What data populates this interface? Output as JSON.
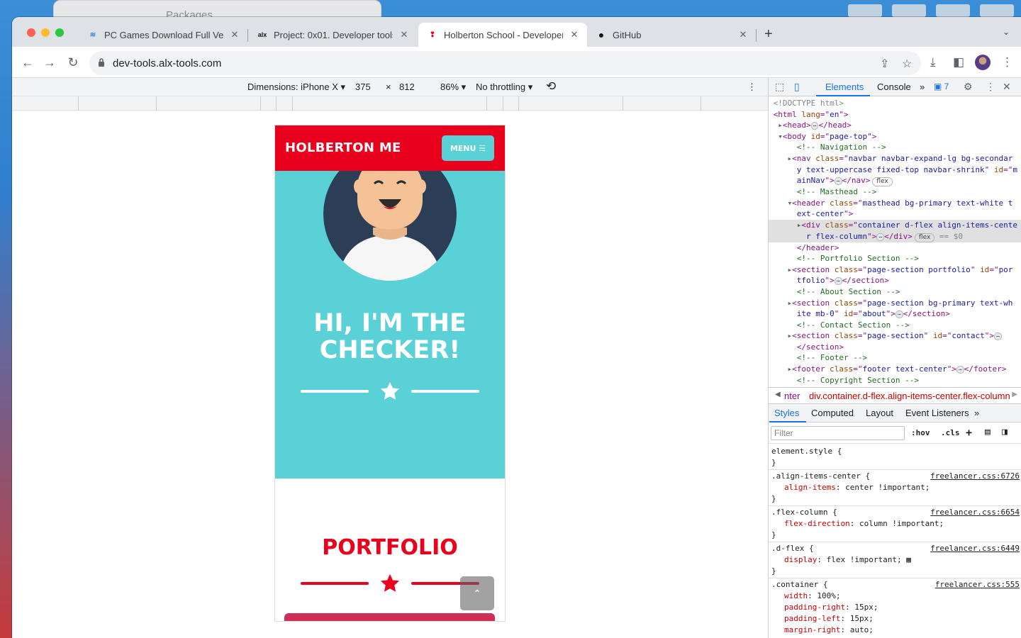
{
  "background_window": {
    "title": "Packages"
  },
  "tabs": [
    {
      "title": "PC Games Download Full Vers",
      "active": false
    },
    {
      "title": "Project: 0x01. Developer tools",
      "active": false
    },
    {
      "title": "Holberton School - Developer",
      "active": true
    },
    {
      "title": "GitHub",
      "active": false
    }
  ],
  "favicons": {
    "tab1": "≋",
    "tab2": "alx",
    "tab3": "❢",
    "tab4": "●"
  },
  "address": {
    "url": "dev-tools.alx-tools.com"
  },
  "device_toolbar": {
    "dimensions": "Dimensions: iPhone X ▾",
    "width": "375",
    "times": "×",
    "height": "812",
    "zoom": "86% ▾",
    "throttling": "No throttling ▾"
  },
  "page": {
    "brand": "HOLBERTON ME",
    "menu": "MENU ☰",
    "hero_title": "HI, I'M THE CHECKER!",
    "portfolio_title": "PORTFOLIO",
    "scroll_top": "⌃"
  },
  "devtools": {
    "tabs": [
      "Elements",
      "Console",
      "»"
    ],
    "issues_count": "▣ 7",
    "breadcrumb_prefix": "nter",
    "breadcrumb": "div.container.d-flex.align-items-center.flex-column",
    "style_tabs": [
      "Styles",
      "Computed",
      "Layout",
      "Event Listeners",
      "»"
    ],
    "filter_placeholder": "Filter",
    "hov": ":hov",
    "cls": ".cls",
    "dom_lines": [
      {
        "indent": "",
        "parts": [
          [
            "doc",
            "<!DOCTYPE html>"
          ]
        ]
      },
      {
        "indent": "",
        "parts": [
          [
            "tag",
            "<html "
          ],
          [
            "attr",
            "lang"
          ],
          [
            "tag",
            "=\""
          ],
          [
            "val",
            "en"
          ],
          [
            "tag",
            "\">"
          ]
        ]
      },
      {
        "indent": " ▸",
        "parts": [
          [
            "tag",
            "<head>"
          ],
          [
            "ell",
            "⋯"
          ],
          [
            "tag",
            "</head>"
          ]
        ]
      },
      {
        "indent": " ▾",
        "parts": [
          [
            "tag",
            "<body "
          ],
          [
            "attr",
            "id"
          ],
          [
            "tag",
            "=\""
          ],
          [
            "val",
            "page-top"
          ],
          [
            "tag",
            "\">"
          ]
        ]
      },
      {
        "indent": "     ",
        "parts": [
          [
            "com",
            "<!-- Navigation -->"
          ]
        ]
      },
      {
        "indent": "   ▸",
        "parts": [
          [
            "tag",
            "<nav "
          ],
          [
            "attr",
            "class"
          ],
          [
            "tag",
            "=\""
          ],
          [
            "val",
            "navbar navbar-expand-lg bg-secondar"
          ]
        ]
      },
      {
        "indent": "     ",
        "parts": [
          [
            "val",
            "y text-uppercase fixed-top navbar-shrink"
          ],
          [
            "tag",
            "\" "
          ],
          [
            "attr",
            "id"
          ],
          [
            "tag",
            "=\""
          ],
          [
            "val",
            "m"
          ]
        ]
      },
      {
        "indent": "     ",
        "parts": [
          [
            "val",
            "ainNav"
          ],
          [
            "tag",
            "\">"
          ],
          [
            "ell",
            "⋯"
          ],
          [
            "tag",
            "</nav>"
          ],
          [
            "pill",
            "flex"
          ]
        ]
      },
      {
        "indent": "     ",
        "parts": [
          [
            "com",
            "<!-- Masthead -->"
          ]
        ]
      },
      {
        "indent": "   ▾",
        "parts": [
          [
            "tag",
            "<header "
          ],
          [
            "attr",
            "class"
          ],
          [
            "tag",
            "=\""
          ],
          [
            "val",
            "masthead bg-primary text-white t"
          ]
        ]
      },
      {
        "indent": "     ",
        "parts": [
          [
            "val",
            "ext-center"
          ],
          [
            "tag",
            "\">"
          ]
        ]
      },
      {
        "indent": "     ▸",
        "sel": true,
        "parts": [
          [
            "tag",
            "<div "
          ],
          [
            "attr",
            "class"
          ],
          [
            "tag",
            "=\""
          ],
          [
            "val",
            "container d-flex align-items-cente"
          ]
        ]
      },
      {
        "indent": "       ",
        "sel": true,
        "parts": [
          [
            "val",
            "r flex-column"
          ],
          [
            "tag",
            "\">"
          ],
          [
            "ell",
            "⋯"
          ],
          [
            "tag",
            "</div>"
          ],
          [
            "pill",
            "flex"
          ],
          [
            "doc",
            " == $0"
          ]
        ]
      },
      {
        "indent": "     ",
        "parts": [
          [
            "tag",
            "</header>"
          ]
        ]
      },
      {
        "indent": "     ",
        "parts": [
          [
            "com",
            "<!-- Portfolio Section -->"
          ]
        ]
      },
      {
        "indent": "   ▸",
        "parts": [
          [
            "tag",
            "<section "
          ],
          [
            "attr",
            "class"
          ],
          [
            "tag",
            "=\""
          ],
          [
            "val",
            "page-section portfolio"
          ],
          [
            "tag",
            "\" "
          ],
          [
            "attr",
            "id"
          ],
          [
            "tag",
            "=\""
          ],
          [
            "val",
            "por"
          ]
        ]
      },
      {
        "indent": "     ",
        "parts": [
          [
            "val",
            "tfolio"
          ],
          [
            "tag",
            "\">"
          ],
          [
            "ell",
            "⋯"
          ],
          [
            "tag",
            "</section>"
          ]
        ]
      },
      {
        "indent": "     ",
        "parts": [
          [
            "com",
            "<!-- About Section -->"
          ]
        ]
      },
      {
        "indent": "   ▸",
        "parts": [
          [
            "tag",
            "<section "
          ],
          [
            "attr",
            "class"
          ],
          [
            "tag",
            "=\""
          ],
          [
            "val",
            "page-section bg-primary text-wh"
          ]
        ]
      },
      {
        "indent": "     ",
        "parts": [
          [
            "val",
            "ite mb-0"
          ],
          [
            "tag",
            "\" "
          ],
          [
            "attr",
            "id"
          ],
          [
            "tag",
            "=\""
          ],
          [
            "val",
            "about"
          ],
          [
            "tag",
            "\">"
          ],
          [
            "ell",
            "⋯"
          ],
          [
            "tag",
            "</section>"
          ]
        ]
      },
      {
        "indent": "     ",
        "parts": [
          [
            "com",
            "<!-- Contact Section -->"
          ]
        ]
      },
      {
        "indent": "   ▸",
        "parts": [
          [
            "tag",
            "<section "
          ],
          [
            "attr",
            "class"
          ],
          [
            "tag",
            "=\""
          ],
          [
            "val",
            "page-section"
          ],
          [
            "tag",
            "\" "
          ],
          [
            "attr",
            "id"
          ],
          [
            "tag",
            "=\""
          ],
          [
            "val",
            "contact"
          ],
          [
            "tag",
            "\">"
          ],
          [
            "ell",
            "⋯"
          ]
        ]
      },
      {
        "indent": "     ",
        "parts": [
          [
            "tag",
            "</section>"
          ]
        ]
      },
      {
        "indent": "     ",
        "parts": [
          [
            "com",
            "<!-- Footer -->"
          ]
        ]
      },
      {
        "indent": "   ▸",
        "parts": [
          [
            "tag",
            "<footer "
          ],
          [
            "attr",
            "class"
          ],
          [
            "tag",
            "=\""
          ],
          [
            "val",
            "footer text-center"
          ],
          [
            "tag",
            "\">"
          ],
          [
            "ell",
            "⋯"
          ],
          [
            "tag",
            "</footer>"
          ]
        ]
      },
      {
        "indent": "     ",
        "parts": [
          [
            "com",
            "<!-- Copyright Section -->"
          ]
        ]
      }
    ],
    "rules": [
      {
        "selector": "element.style {",
        "source": "",
        "decls": [],
        "close": "}"
      },
      {
        "selector": ".align-items-center {",
        "source": "freelancer.css:6726",
        "decls": [
          [
            "align-items",
            ": center !important;"
          ]
        ],
        "close": "}"
      },
      {
        "selector": ".flex-column {",
        "source": "freelancer.css:6654",
        "decls": [
          [
            "flex-direction",
            ": column !important;"
          ]
        ],
        "close": "}"
      },
      {
        "selector": ".d-flex {",
        "source": "freelancer.css:6449",
        "decls": [
          [
            "display",
            ": flex !important; ▦"
          ]
        ],
        "close": "}"
      },
      {
        "selector": ".container {",
        "source": "freelancer.css:555",
        "decls": [
          [
            "width",
            ": 100%;"
          ],
          [
            "padding-right",
            ": 15px;"
          ],
          [
            "padding-left",
            ": 15px;"
          ],
          [
            "margin-right",
            ": auto;"
          ],
          [
            "margin-left",
            ": auto;"
          ]
        ],
        "close": ""
      }
    ]
  },
  "colors": {
    "brand_red": "#e8001d",
    "masthead_teal": "#59d1d6",
    "devtools_blue": "#1a73e8"
  }
}
